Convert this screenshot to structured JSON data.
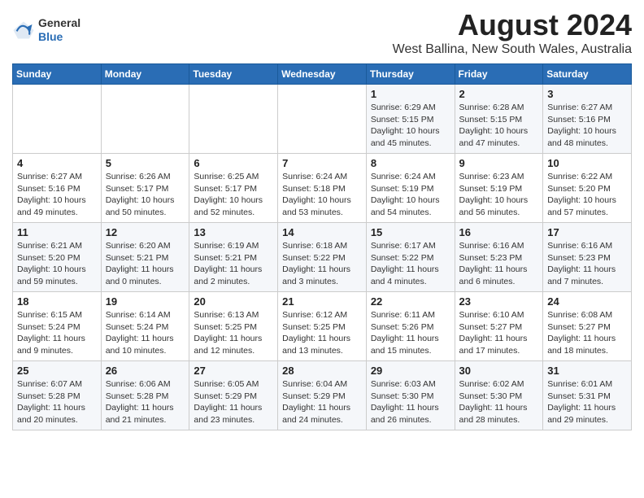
{
  "header": {
    "logo_general": "General",
    "logo_blue": "Blue",
    "title": "August 2024",
    "subtitle": "West Ballina, New South Wales, Australia"
  },
  "calendar": {
    "days_of_week": [
      "Sunday",
      "Monday",
      "Tuesday",
      "Wednesday",
      "Thursday",
      "Friday",
      "Saturday"
    ],
    "weeks": [
      [
        {
          "day": "",
          "info": ""
        },
        {
          "day": "",
          "info": ""
        },
        {
          "day": "",
          "info": ""
        },
        {
          "day": "",
          "info": ""
        },
        {
          "day": "1",
          "info": "Sunrise: 6:29 AM\nSunset: 5:15 PM\nDaylight: 10 hours\nand 45 minutes."
        },
        {
          "day": "2",
          "info": "Sunrise: 6:28 AM\nSunset: 5:15 PM\nDaylight: 10 hours\nand 47 minutes."
        },
        {
          "day": "3",
          "info": "Sunrise: 6:27 AM\nSunset: 5:16 PM\nDaylight: 10 hours\nand 48 minutes."
        }
      ],
      [
        {
          "day": "4",
          "info": "Sunrise: 6:27 AM\nSunset: 5:16 PM\nDaylight: 10 hours\nand 49 minutes."
        },
        {
          "day": "5",
          "info": "Sunrise: 6:26 AM\nSunset: 5:17 PM\nDaylight: 10 hours\nand 50 minutes."
        },
        {
          "day": "6",
          "info": "Sunrise: 6:25 AM\nSunset: 5:17 PM\nDaylight: 10 hours\nand 52 minutes."
        },
        {
          "day": "7",
          "info": "Sunrise: 6:24 AM\nSunset: 5:18 PM\nDaylight: 10 hours\nand 53 minutes."
        },
        {
          "day": "8",
          "info": "Sunrise: 6:24 AM\nSunset: 5:19 PM\nDaylight: 10 hours\nand 54 minutes."
        },
        {
          "day": "9",
          "info": "Sunrise: 6:23 AM\nSunset: 5:19 PM\nDaylight: 10 hours\nand 56 minutes."
        },
        {
          "day": "10",
          "info": "Sunrise: 6:22 AM\nSunset: 5:20 PM\nDaylight: 10 hours\nand 57 minutes."
        }
      ],
      [
        {
          "day": "11",
          "info": "Sunrise: 6:21 AM\nSunset: 5:20 PM\nDaylight: 10 hours\nand 59 minutes."
        },
        {
          "day": "12",
          "info": "Sunrise: 6:20 AM\nSunset: 5:21 PM\nDaylight: 11 hours\nand 0 minutes."
        },
        {
          "day": "13",
          "info": "Sunrise: 6:19 AM\nSunset: 5:21 PM\nDaylight: 11 hours\nand 2 minutes."
        },
        {
          "day": "14",
          "info": "Sunrise: 6:18 AM\nSunset: 5:22 PM\nDaylight: 11 hours\nand 3 minutes."
        },
        {
          "day": "15",
          "info": "Sunrise: 6:17 AM\nSunset: 5:22 PM\nDaylight: 11 hours\nand 4 minutes."
        },
        {
          "day": "16",
          "info": "Sunrise: 6:16 AM\nSunset: 5:23 PM\nDaylight: 11 hours\nand 6 minutes."
        },
        {
          "day": "17",
          "info": "Sunrise: 6:16 AM\nSunset: 5:23 PM\nDaylight: 11 hours\nand 7 minutes."
        }
      ],
      [
        {
          "day": "18",
          "info": "Sunrise: 6:15 AM\nSunset: 5:24 PM\nDaylight: 11 hours\nand 9 minutes."
        },
        {
          "day": "19",
          "info": "Sunrise: 6:14 AM\nSunset: 5:24 PM\nDaylight: 11 hours\nand 10 minutes."
        },
        {
          "day": "20",
          "info": "Sunrise: 6:13 AM\nSunset: 5:25 PM\nDaylight: 11 hours\nand 12 minutes."
        },
        {
          "day": "21",
          "info": "Sunrise: 6:12 AM\nSunset: 5:25 PM\nDaylight: 11 hours\nand 13 minutes."
        },
        {
          "day": "22",
          "info": "Sunrise: 6:11 AM\nSunset: 5:26 PM\nDaylight: 11 hours\nand 15 minutes."
        },
        {
          "day": "23",
          "info": "Sunrise: 6:10 AM\nSunset: 5:27 PM\nDaylight: 11 hours\nand 17 minutes."
        },
        {
          "day": "24",
          "info": "Sunrise: 6:08 AM\nSunset: 5:27 PM\nDaylight: 11 hours\nand 18 minutes."
        }
      ],
      [
        {
          "day": "25",
          "info": "Sunrise: 6:07 AM\nSunset: 5:28 PM\nDaylight: 11 hours\nand 20 minutes."
        },
        {
          "day": "26",
          "info": "Sunrise: 6:06 AM\nSunset: 5:28 PM\nDaylight: 11 hours\nand 21 minutes."
        },
        {
          "day": "27",
          "info": "Sunrise: 6:05 AM\nSunset: 5:29 PM\nDaylight: 11 hours\nand 23 minutes."
        },
        {
          "day": "28",
          "info": "Sunrise: 6:04 AM\nSunset: 5:29 PM\nDaylight: 11 hours\nand 24 minutes."
        },
        {
          "day": "29",
          "info": "Sunrise: 6:03 AM\nSunset: 5:30 PM\nDaylight: 11 hours\nand 26 minutes."
        },
        {
          "day": "30",
          "info": "Sunrise: 6:02 AM\nSunset: 5:30 PM\nDaylight: 11 hours\nand 28 minutes."
        },
        {
          "day": "31",
          "info": "Sunrise: 6:01 AM\nSunset: 5:31 PM\nDaylight: 11 hours\nand 29 minutes."
        }
      ]
    ]
  }
}
